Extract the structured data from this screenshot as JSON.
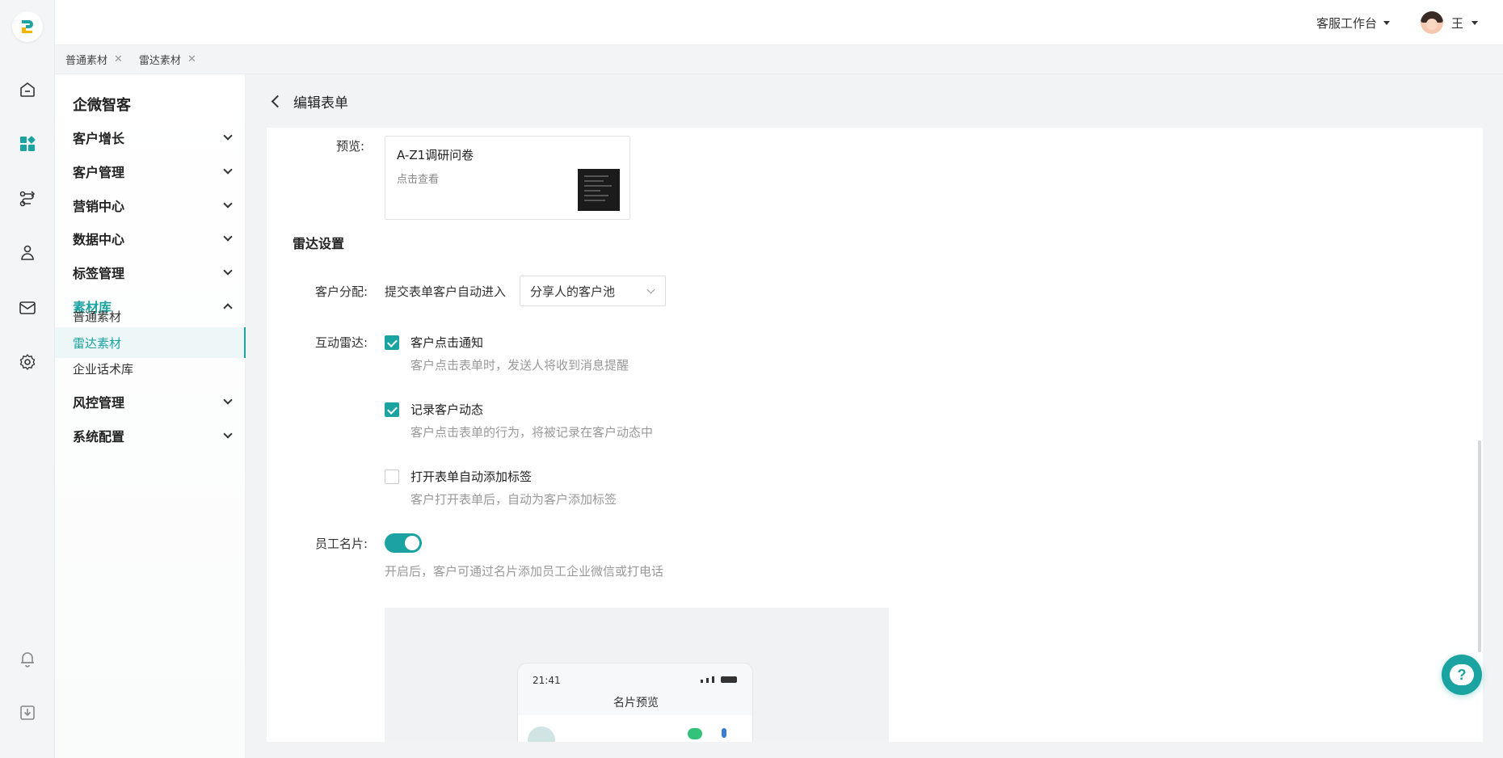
{
  "header": {
    "workspace_label": "客服工作台",
    "user_name": "王"
  },
  "tabs": [
    {
      "label": "普通素材"
    },
    {
      "label": "雷达素材"
    }
  ],
  "menu": {
    "title": "企微智客",
    "groups": [
      {
        "label": "客户增长"
      },
      {
        "label": "客户管理"
      },
      {
        "label": "营销中心"
      },
      {
        "label": "数据中心"
      },
      {
        "label": "标签管理"
      },
      {
        "label": "素材库"
      },
      {
        "label": "风控管理"
      },
      {
        "label": "系统配置"
      }
    ],
    "sub_items": [
      {
        "label": "普通素材"
      },
      {
        "label": "雷达素材"
      },
      {
        "label": "企业话术库"
      }
    ]
  },
  "page": {
    "title": "编辑表单"
  },
  "form": {
    "preview_label": "预览:",
    "preview_title": "A-Z1调研问卷",
    "preview_sub": "点击查看",
    "section_title": "雷达设置",
    "assign_label": "客户分配:",
    "assign_text": "提交表单客户自动进入",
    "assign_value": "分享人的客户池",
    "radar_label": "互动雷达:",
    "options": [
      {
        "label": "客户点击通知",
        "hint": "客户点击表单时，发送人将收到消息提醒",
        "checked": true
      },
      {
        "label": "记录客户动态",
        "hint": "客户点击表单的行为，将被记录在客户动态中",
        "checked": true
      },
      {
        "label": "打开表单自动添加标签",
        "hint": "客户打开表单后，自动为客户添加标签",
        "checked": false
      }
    ],
    "card_label": "员工名片:",
    "card_enabled": true,
    "card_hint": "开启后，客户可通过名片添加员工企业微信或打电话"
  },
  "phone": {
    "time": "21:41",
    "title": "名片预览"
  },
  "colors": {
    "accent": "#1aa3a1"
  }
}
